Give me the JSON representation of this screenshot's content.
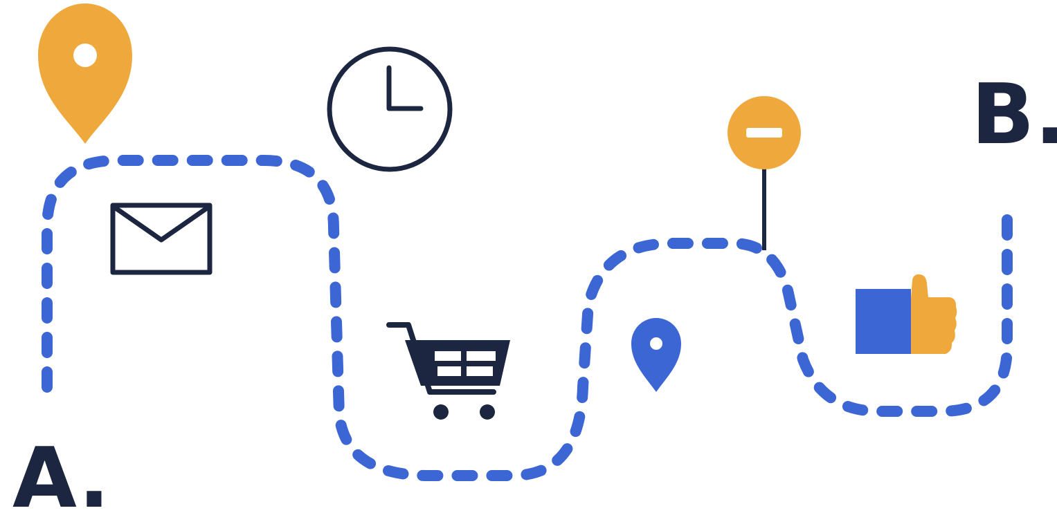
{
  "start_label": "A.",
  "end_label": "B.",
  "colors": {
    "path": "#3B66D4",
    "ink": "#1C2640",
    "orange": "#EFA83C",
    "background": "#FFFFFF"
  },
  "icons": [
    "map-pin-orange-icon",
    "clock-icon",
    "envelope-icon",
    "shopping-cart-icon",
    "map-pin-blue-icon",
    "no-entry-sign-icon",
    "thumbs-up-icon"
  ]
}
